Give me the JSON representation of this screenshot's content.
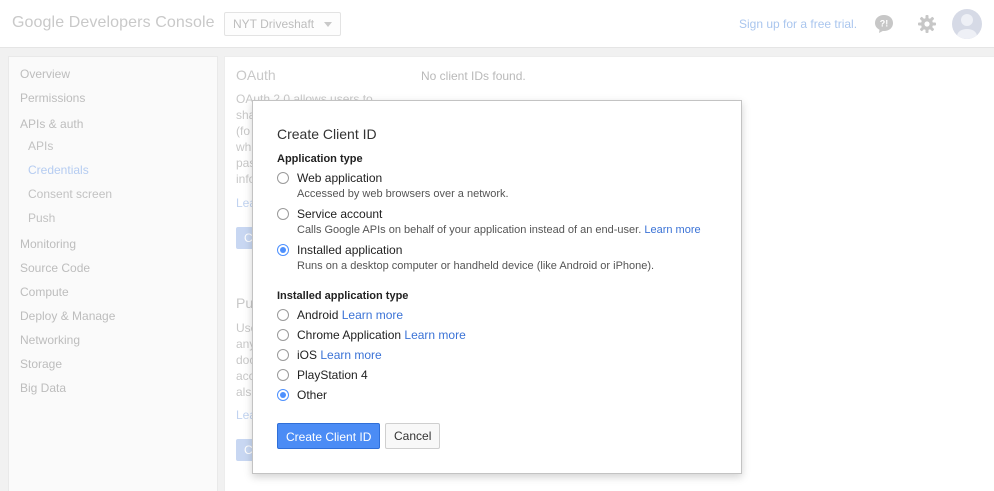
{
  "header": {
    "logo": "Google Developers Console",
    "project": "NYT Driveshaft",
    "signup": "Sign up for a free trial."
  },
  "sidebar": {
    "items": [
      {
        "label": "Overview"
      },
      {
        "label": "Permissions"
      },
      {
        "label": "APIs & auth"
      },
      {
        "label": "APIs"
      },
      {
        "label": "Credentials"
      },
      {
        "label": "Consent screen"
      },
      {
        "label": "Push"
      },
      {
        "label": "Monitoring"
      },
      {
        "label": "Source Code"
      },
      {
        "label": "Compute"
      },
      {
        "label": "Deploy & Manage"
      },
      {
        "label": "Networking"
      },
      {
        "label": "Storage"
      },
      {
        "label": "Big Data"
      }
    ]
  },
  "main": {
    "oauth_title": "OAuth",
    "oauth_desc_lines": [
      "OAuth 2.0 allows users to",
      "sha",
      "(fo",
      "whi",
      "pas",
      "info"
    ],
    "oauth_link": "Lea",
    "no_clients": "No client IDs found.",
    "public_title": "Pu",
    "public_desc_lines": [
      "Use",
      "any",
      "doc",
      "acc",
      "als"
    ],
    "public_link": "Lea",
    "btn_fragment": "C"
  },
  "dialog": {
    "title": "Create Client ID",
    "app_type_label": "Application type",
    "app_types": [
      {
        "label": "Web application",
        "desc": "Accessed by web browsers over a network.",
        "link": "",
        "checked": false
      },
      {
        "label": "Service account",
        "desc": "Calls Google APIs on behalf of your application instead of an end-user.",
        "link": "Learn more",
        "checked": false
      },
      {
        "label": "Installed application",
        "desc": "Runs on a desktop computer or handheld device (like Android or iPhone).",
        "link": "",
        "checked": true
      }
    ],
    "installed_type_label": "Installed application type",
    "installed_types": [
      {
        "label": "Android",
        "link": "Learn more",
        "checked": false
      },
      {
        "label": "Chrome Application",
        "link": "Learn more",
        "checked": false
      },
      {
        "label": "iOS",
        "link": "Learn more",
        "checked": false
      },
      {
        "label": "PlayStation 4",
        "link": "",
        "checked": false
      },
      {
        "label": "Other",
        "link": "",
        "checked": true
      }
    ],
    "create_label": "Create Client ID",
    "cancel_label": "Cancel"
  }
}
